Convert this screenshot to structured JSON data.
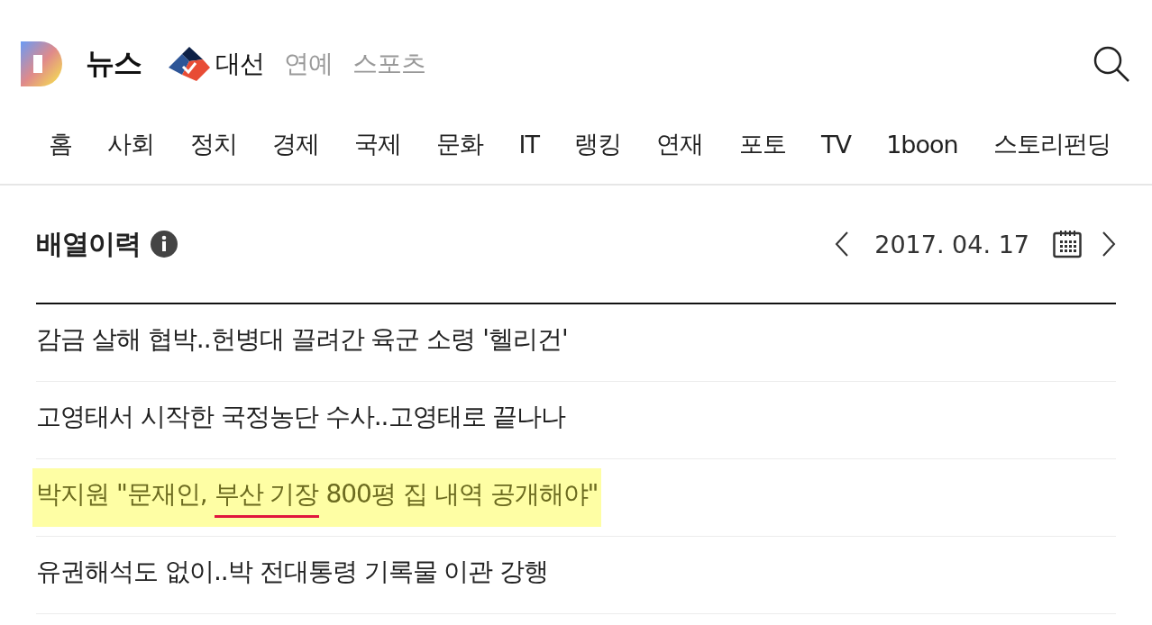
{
  "brand": {
    "name": "뉴스"
  },
  "top_links": [
    {
      "label": "대선",
      "selected": true,
      "kind": "logo"
    },
    {
      "label": "연예",
      "selected": false,
      "kind": "text"
    },
    {
      "label": "스포츠",
      "selected": false,
      "kind": "text"
    }
  ],
  "nav": [
    {
      "label": "홈"
    },
    {
      "label": "사회"
    },
    {
      "label": "정치"
    },
    {
      "label": "경제"
    },
    {
      "label": "국제"
    },
    {
      "label": "문화"
    },
    {
      "label": "IT"
    },
    {
      "label": "랭킹"
    },
    {
      "label": "연재"
    },
    {
      "label": "포토"
    },
    {
      "label": "TV"
    },
    {
      "label": "1boon"
    },
    {
      "label": "스토리펀딩"
    }
  ],
  "section": {
    "title": "배열이력",
    "date": "2017. 04. 17"
  },
  "articles": [
    {
      "highlighted": false,
      "parts": [
        {
          "text": "감금 살해 협박..헌병대 끌려간 육군 소령 '헬리건'",
          "underlined": false
        }
      ]
    },
    {
      "highlighted": false,
      "parts": [
        {
          "text": "고영태서 시작한 국정농단 수사..고영태로 끝나나",
          "underlined": false
        }
      ]
    },
    {
      "highlighted": true,
      "parts": [
        {
          "text": "박지원 \"문재인, ",
          "underlined": false
        },
        {
          "text": "부산 기장",
          "underlined": true
        },
        {
          "text": " 800평 집 내역 공개해야\"",
          "underlined": false
        }
      ]
    },
    {
      "highlighted": false,
      "parts": [
        {
          "text": "유권해석도 없이..박 전대통령 기록물 이관 강행",
          "underlined": false
        }
      ]
    }
  ]
}
